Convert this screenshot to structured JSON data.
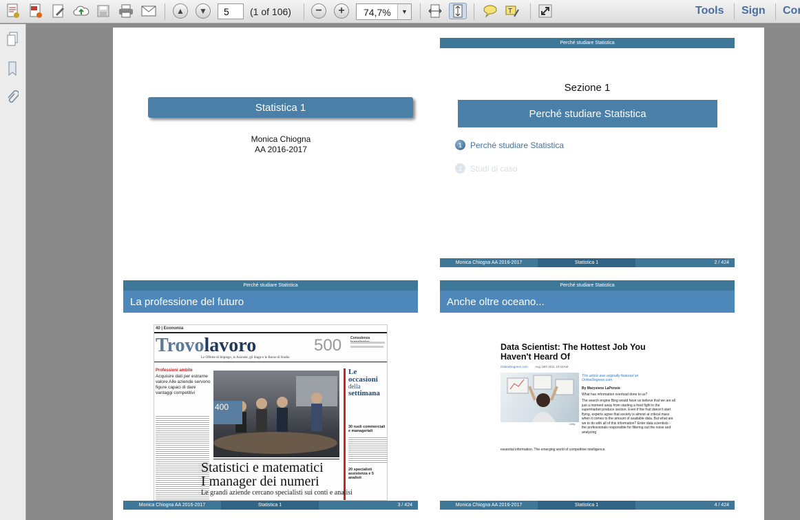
{
  "toolbar": {
    "page_current": "5",
    "page_total": "(1 of 106)",
    "zoom": "74,7%",
    "tools_label": "Tools",
    "sign_label": "Sign",
    "comment_label": "Cor"
  },
  "slides": {
    "s1": {
      "title": "Statistica 1",
      "author": "Monica Chiogna",
      "year": "AA 2016-2017"
    },
    "s2": {
      "header": "Perché studiare Statistica",
      "section": "Sezione 1",
      "box": "Perché studiare Statistica",
      "toc1_num": "1",
      "toc1": "Perché studiare Statistica",
      "toc2_num": "2",
      "toc2": "Studi di caso",
      "footer_left": "Monica Chiogna  AA 2016-2017",
      "footer_mid": "Statistica 1",
      "footer_right": "2 / 424"
    },
    "s3": {
      "header": "Perché studiare Statistica",
      "title": "La professione del futuro",
      "footer_left": "Monica Chiogna  AA 2016-2017",
      "footer_mid": "Statistica 1",
      "footer_right": "3 / 424",
      "news": {
        "section": "40 | Economia",
        "masthead_a": "Trovo",
        "masthead_b": "lavoro",
        "number": "500",
        "tagline": "Le Offerte di Impiego, le Aziende, gli Stage e le Borse di Studio",
        "side_heading": "Professioni ambite",
        "side_text": "Acquisire dati per estrarne valore Alle aziende servono figure capaci di dare vantaggi competitivi",
        "photo_badge": "400",
        "right_title_a": "Le occasioni",
        "right_title_b": "della",
        "right_title_c": "settimana",
        "right_sub": "30 ruoli commerciali e manageriali",
        "right_sub2": "20 specialisti assistenza e 5 analisti",
        "headline1": "Statistici e matematici",
        "headline2": "I manager dei numeri",
        "headline3": "Le grandi aziende cercano specialisti sui conti e analisi",
        "top_box": "Consulenza tecnologica"
      }
    },
    "s4": {
      "header": "Perché studiare Statistica",
      "title": "Anche oltre oceano...",
      "footer_left": "Monica Chiogna  AA 2016-2017",
      "footer_mid": "Statistica 1",
      "footer_right": "4 / 424",
      "article": {
        "title": "Data Scientist: The Hottest Job You Haven't Heard Of",
        "source": "OnlineDegrees.com",
        "date": "Aug 15th 2011 10:02AM",
        "featured": "This article was originally featured on OnlineDegrees.com",
        "byline": "By Marysiene LaPonsie",
        "q": "What has information overload done to us?",
        "body": "The search engine Bing would have us believe that we are all just a moment away from starting a food fight in the supermarket produce section. Even if the fruit doesn't start flying, experts agree that society is almost at critical mass when it comes to the amount of available data. But what are we to do with all of this information? Enter data scientists - the professionals responsible for filtering out the noise and analyzing",
        "body_end": "essential information. The emerging world of competitive intelligence.",
        "caption": "Getty"
      }
    }
  }
}
